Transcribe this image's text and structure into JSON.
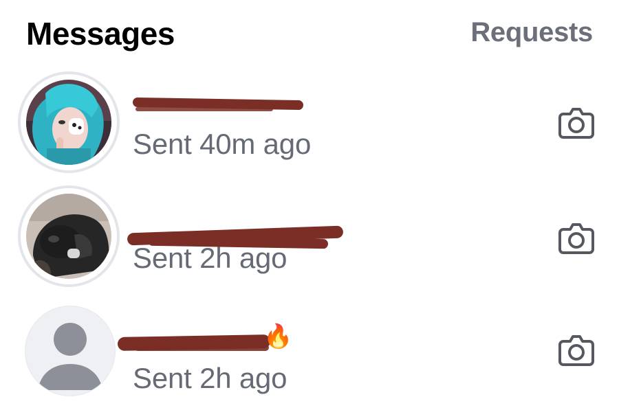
{
  "header": {
    "title": "Messages",
    "requests_label": "Requests"
  },
  "threads": [
    {
      "avatar": "profile-photo",
      "status": "Sent 40m ago",
      "action_icon": "camera-icon",
      "emoji": ""
    },
    {
      "avatar": "profile-photo",
      "status": "Sent 2h ago",
      "action_icon": "camera-icon",
      "emoji": ""
    },
    {
      "avatar": "default-avatar",
      "status": "Sent 2h ago",
      "action_icon": "camera-icon",
      "emoji": "🔥"
    }
  ],
  "colors": {
    "title": "#000000",
    "secondary_text": "#666a75",
    "redaction": "#7b2e25",
    "avatar_ring": "#e3e5ea"
  }
}
